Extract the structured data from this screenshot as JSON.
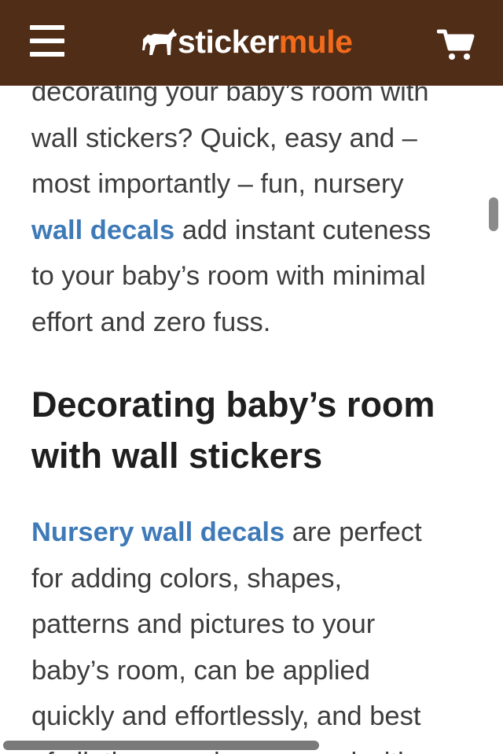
{
  "header": {
    "logo_part1": "sticker",
    "logo_part2": "mule",
    "colors": {
      "background": "#502d16",
      "accent": "#f26b1d",
      "link": "#3e7ab8"
    },
    "icons": {
      "menu": "hamburger-menu-icon",
      "logo": "mule-icon",
      "cart": "shopping-cart-icon"
    }
  },
  "article": {
    "intro": {
      "line1": "decorating your baby’s room with",
      "line2": "wall stickers? Quick, easy and –",
      "line3": "most importantly – fun, nursery",
      "link": "wall decals",
      "after_link": " add instant cuteness",
      "line5": "to your baby’s room with minimal",
      "line6": "effort and zero fuss."
    },
    "heading_line1": "Decorating baby’s room",
    "heading_line2": "with wall stickers",
    "body": {
      "link": "Nursery wall decals",
      "after_link": " are perfect",
      "line2": "for adding colors, shapes,",
      "line3": "patterns and pictures to your",
      "line4": "baby’s room, can be applied",
      "line5": "quickly and effortlessly, and best",
      "line6": "of all, they can be removed with"
    }
  }
}
